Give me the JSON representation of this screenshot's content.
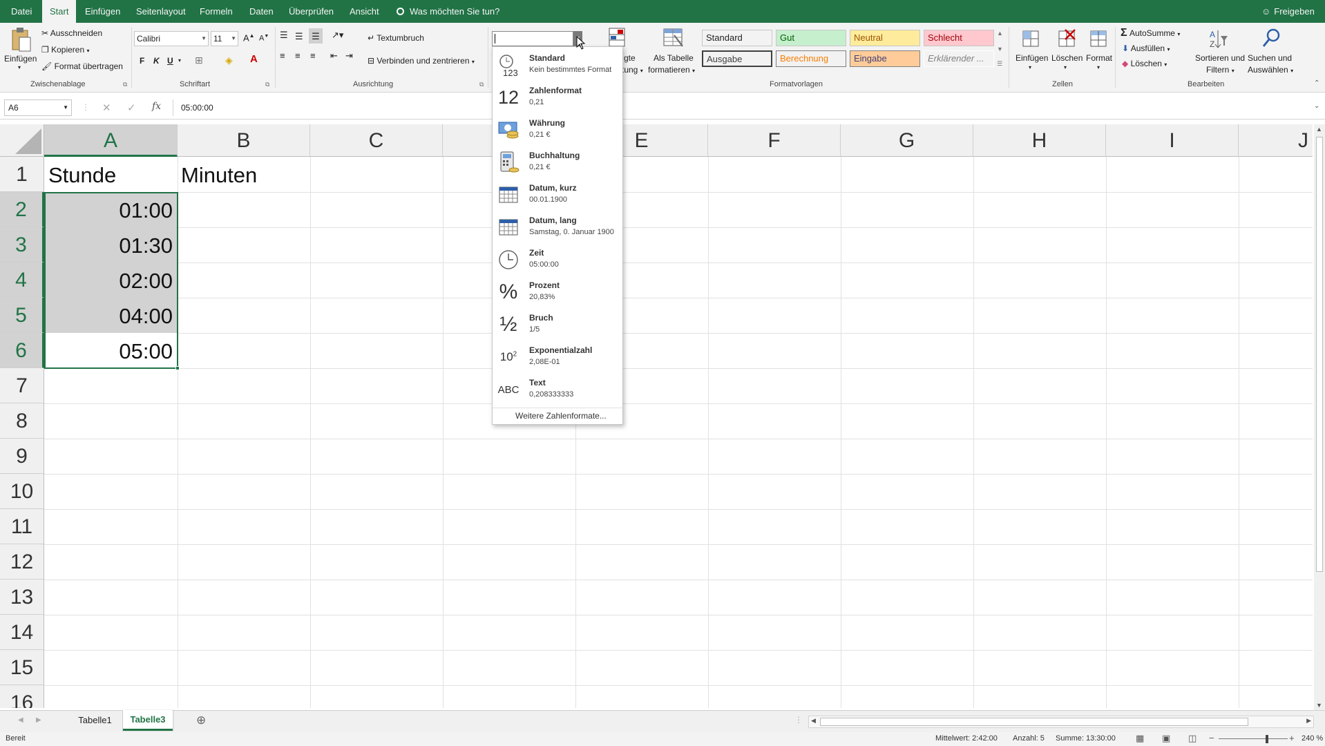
{
  "menu": {
    "file": "Datei",
    "tabs": [
      "Start",
      "Einfügen",
      "Seitenlayout",
      "Formeln",
      "Daten",
      "Überprüfen",
      "Ansicht"
    ],
    "tell_me": "Was möchten Sie tun?",
    "share": "Freigeben"
  },
  "ribbon": {
    "clipboard": {
      "paste": "Einfügen",
      "cut": "Ausschneiden",
      "copy": "Kopieren",
      "format_painter": "Format übertragen",
      "group": "Zwischenablage"
    },
    "font": {
      "name": "Calibri",
      "size": "11",
      "bold": "F",
      "italic": "K",
      "underline": "U",
      "group": "Schriftart"
    },
    "alignment": {
      "wrap": "Textumbruch",
      "merge": "Verbinden und zentrieren",
      "group": "Ausrichtung"
    },
    "number": {
      "format_value": ""
    },
    "styles": {
      "cond_partial_1": "gte",
      "cond_partial_2": "tung",
      "as_table_1": "Als Tabelle",
      "as_table_2": "formatieren",
      "cells": [
        {
          "label": "Standard",
          "bg": "#ffffff",
          "fg": "#222222"
        },
        {
          "label": "Gut",
          "bg": "#c6efce",
          "fg": "#006100"
        },
        {
          "label": "Neutral",
          "bg": "#ffeb9c",
          "fg": "#9c5700"
        },
        {
          "label": "Schlecht",
          "bg": "#ffc7ce",
          "fg": "#9c0006"
        },
        {
          "label": "Ausgabe",
          "bg": "#f2f2f2",
          "fg": "#3f3f3f"
        },
        {
          "label": "Berechnung",
          "bg": "#f2f2f2",
          "fg": "#fa7d00"
        },
        {
          "label": "Eingabe",
          "bg": "#ffcc99",
          "fg": "#3f3f76"
        },
        {
          "label": "Erklärender ...",
          "bg": "#ffffff",
          "fg": "#7f7f7f"
        }
      ],
      "group": "Formatvorlagen"
    },
    "cells": {
      "insert": "Einfügen",
      "delete": "Löschen",
      "format": "Format",
      "group": "Zellen"
    },
    "editing": {
      "autosum": "AutoSumme",
      "fill": "Ausfüllen",
      "clear": "Löschen",
      "sort_1": "Sortieren und",
      "sort_2": "Filtern",
      "find_1": "Suchen und",
      "find_2": "Auswählen",
      "group": "Bearbeiten"
    }
  },
  "formula_bar": {
    "name_box": "A6",
    "fx": "fx",
    "value": "05:00:00"
  },
  "grid": {
    "columns": [
      "A",
      "B",
      "C",
      "D",
      "E",
      "F",
      "G",
      "H",
      "I",
      "J"
    ],
    "rows": [
      "1",
      "2",
      "3",
      "4",
      "5",
      "6",
      "7",
      "8",
      "9",
      "10",
      "11",
      "12",
      "13",
      "14",
      "15",
      "16"
    ],
    "cells": {
      "A1": "Stunde",
      "B1": "Minuten",
      "A2": "01:00",
      "A3": "01:30",
      "A4": "02:00",
      "A5": "04:00",
      "A6": "05:00"
    }
  },
  "format_dropdown": {
    "items": [
      {
        "name": "Standard",
        "sample": "Kein bestimmtes Format",
        "icon": "clock-123-icon"
      },
      {
        "name": "Zahlenformat",
        "sample": "0,21",
        "icon": "number-12-icon"
      },
      {
        "name": "Währung",
        "sample": "0,21 €",
        "icon": "currency-icon"
      },
      {
        "name": "Buchhaltung",
        "sample": "0,21 €",
        "icon": "accounting-icon"
      },
      {
        "name": "Datum, kurz",
        "sample": "00.01.1900",
        "icon": "calendar-short-icon"
      },
      {
        "name": "Datum, lang",
        "sample": "Samstag, 0. Januar 1900",
        "icon": "calendar-long-icon"
      },
      {
        "name": "Zeit",
        "sample": "05:00:00",
        "icon": "clock-icon"
      },
      {
        "name": "Prozent",
        "sample": "20,83%",
        "icon": "percent-icon"
      },
      {
        "name": "Bruch",
        "sample": "1/5",
        "icon": "fraction-icon"
      },
      {
        "name": "Exponentialzahl",
        "sample": "2,08E-01",
        "icon": "exponent-icon"
      },
      {
        "name": "Text",
        "sample": "0,208333333",
        "icon": "text-abc-icon"
      }
    ],
    "glyphs": {
      "number": "12",
      "percent": "%",
      "fraction": "½",
      "exp_base": "10",
      "exp_power": "2",
      "abc": "ABC",
      "std_digits": "123"
    },
    "more": "Weitere Zahlenformate..."
  },
  "sheet_tabs": [
    "Tabelle1",
    "Tabelle3"
  ],
  "active_sheet": "Tabelle3",
  "status": {
    "ready": "Bereit",
    "average": "Mittelwert: 2:42:00",
    "count": "Anzahl: 5",
    "sum": "Summe: 13:30:00",
    "zoom": "240 %"
  },
  "colors": {
    "accent": "#217346",
    "selection": "#d2d2d2"
  }
}
